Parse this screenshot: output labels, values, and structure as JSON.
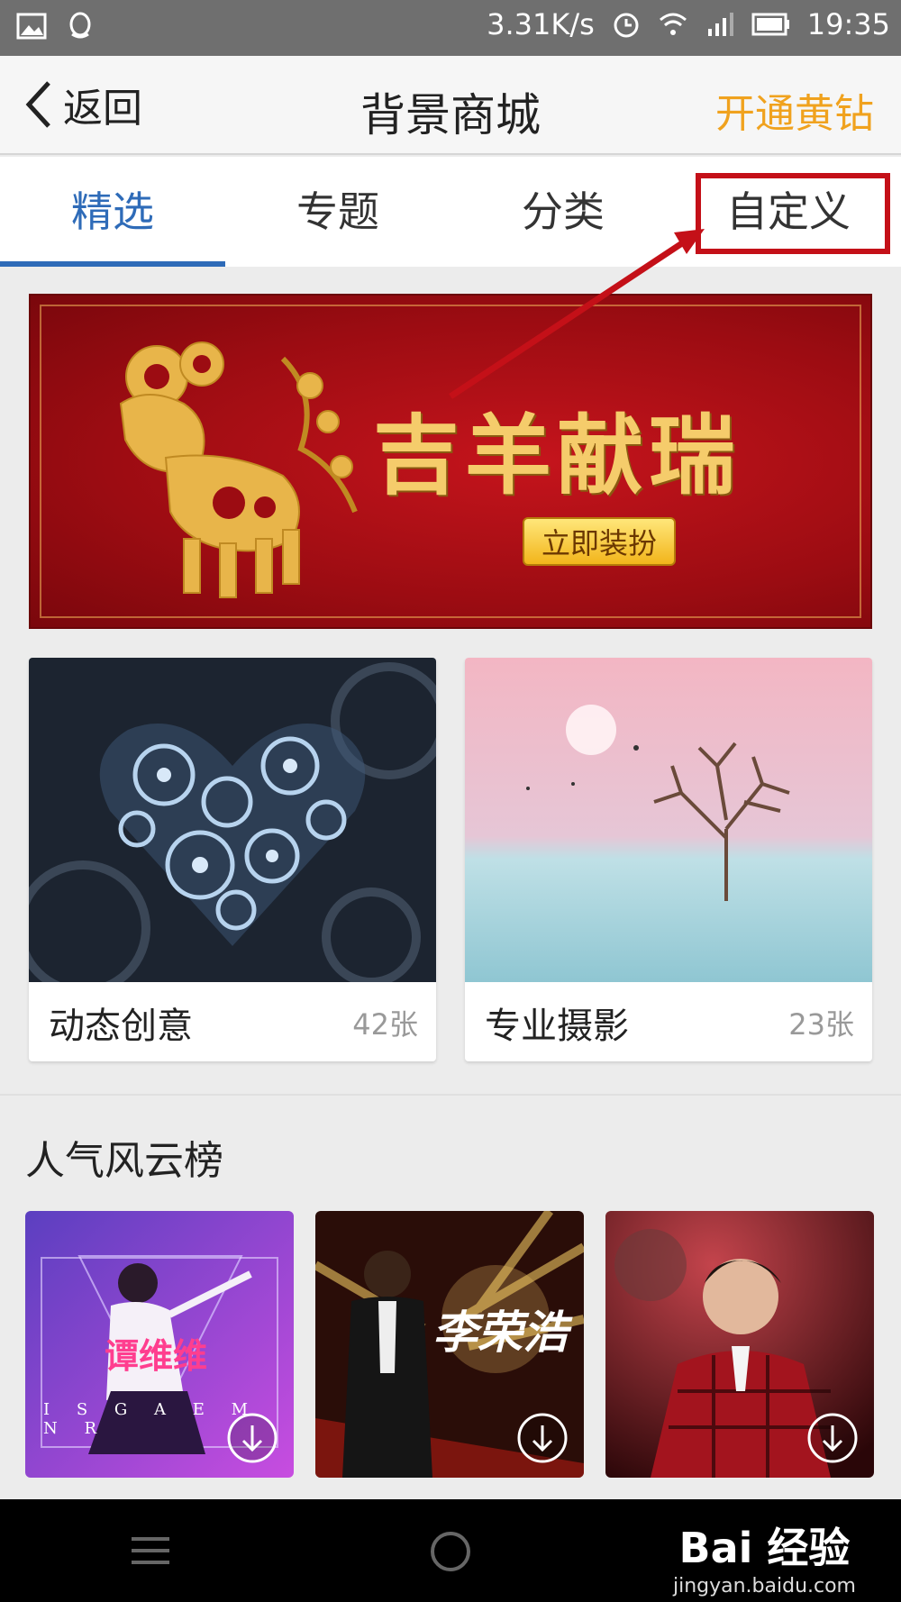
{
  "status_bar": {
    "network_speed": "3.31K/s",
    "time": "19:35"
  },
  "header": {
    "back_label": "返回",
    "title": "背景商城",
    "vip_label": "开通黄钻"
  },
  "tabs": [
    {
      "label": "精选",
      "active": true
    },
    {
      "label": "专题",
      "active": false
    },
    {
      "label": "分类",
      "active": false
    },
    {
      "label": "自定义",
      "active": false
    }
  ],
  "banner": {
    "title": "吉羊献瑞",
    "button_label": "立即装扮"
  },
  "categories": [
    {
      "name": "动态创意",
      "count": "42张"
    },
    {
      "name": "专业摄影",
      "count": "23张"
    }
  ],
  "rank_section": {
    "title": "人气风云榜",
    "items": [
      {
        "overlay_text": "谭维维",
        "letters": "I S G A E M N R"
      },
      {
        "overlay_text": "李荣浩"
      },
      {
        "overlay_text": ""
      }
    ]
  },
  "watermark": {
    "logo": "Bai 经验",
    "url": "jingyan.baidu.com"
  },
  "colors": {
    "accent": "#2e6bb8",
    "vip": "#f0a21e",
    "highlight": "#c41018"
  }
}
